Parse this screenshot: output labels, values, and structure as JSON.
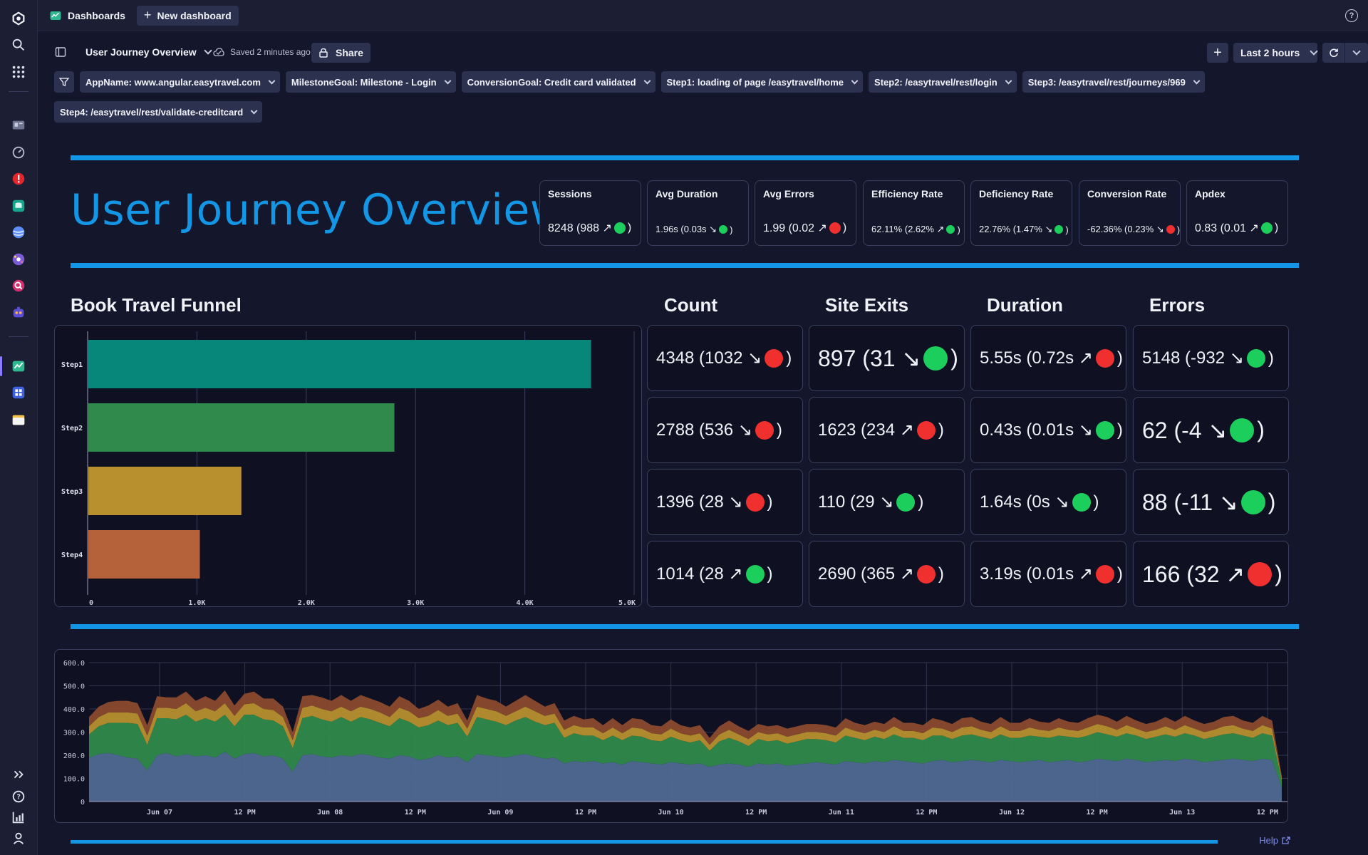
{
  "topbar": {
    "breadcrumb": "Dashboards",
    "new_dashboard": "New dashboard"
  },
  "toolbar": {
    "dashboard_name": "User Journey Overview",
    "saved_status": "Saved 2 minutes ago",
    "share": "Share",
    "timeframe": "Last 2 hours"
  },
  "filters": [
    "AppName: www.angular.easytravel.com",
    "MilestoneGoal: Milestone - Login",
    "ConversionGoal: Credit card validated",
    "Step1: loading of page /easytravel/home",
    "Step2: /easytravel/rest/login",
    "Step3: /easytravel/rest/journeys/969",
    "Step4: /easytravel/rest/validate-creditcard"
  ],
  "header": {
    "title": "User Journey Overview"
  },
  "kpis": [
    {
      "label": "Sessions",
      "value": "8248 (988 ↗",
      "status": "green",
      "close": ")"
    },
    {
      "label": "Avg Duration",
      "value": "1.96s (0.03s ↘",
      "status": "green",
      "close": ")"
    },
    {
      "label": "Avg Errors",
      "value": "1.99 (0.02 ↗",
      "status": "red",
      "close": ")"
    },
    {
      "label": "Efficiency Rate",
      "value": "62.11% (2.62% ↗",
      "status": "green",
      "close": ")"
    },
    {
      "label": "Deficiency Rate",
      "value": "22.76% (1.47% ↘",
      "status": "green",
      "close": ")"
    },
    {
      "label": "Conversion Rate",
      "value": "-62.36% (0.23% ↘",
      "status": "red",
      "close": ")"
    },
    {
      "label": "Apdex",
      "value": "0.83 (0.01 ↗",
      "status": "green",
      "close": ")"
    }
  ],
  "sections": {
    "funnel": "Book Travel Funnel",
    "count": "Count",
    "site_exits": "Site Exits",
    "duration": "Duration",
    "errors": "Errors"
  },
  "tiles": {
    "count": [
      {
        "value": "4348 (1032 ↘",
        "status": "red"
      },
      {
        "value": "2788 (536 ↘",
        "status": "red"
      },
      {
        "value": "1396 (28 ↘",
        "status": "red"
      },
      {
        "value": "1014 (28 ↗",
        "status": "green"
      }
    ],
    "site_exits": [
      {
        "value": "897 (31 ↘",
        "status": "green"
      },
      {
        "value": "1623 (234 ↗",
        "status": "red"
      },
      {
        "value": "110 (29 ↘",
        "status": "green"
      },
      {
        "value": "2690 (365 ↗",
        "status": "red"
      }
    ],
    "duration": [
      {
        "value": "5.55s (0.72s ↗",
        "status": "red"
      },
      {
        "value": "0.43s (0.01s ↘",
        "status": "green"
      },
      {
        "value": "1.64s (0s ↘",
        "status": "green"
      },
      {
        "value": "3.19s (0.01s ↗",
        "status": "red"
      }
    ],
    "errors": [
      {
        "value": "5148 (-932 ↘",
        "status": "green"
      },
      {
        "value": "62 (-4 ↘",
        "status": "green"
      },
      {
        "value": "88 (-11 ↘",
        "status": "green"
      },
      {
        "value": "166 (32 ↗",
        "status": "red"
      }
    ]
  },
  "colors": {
    "accent": "#1496e6",
    "good": "#1ccf5c",
    "bad": "#f0302f"
  },
  "chart_data": [
    {
      "type": "bar",
      "orientation": "horizontal",
      "title": "Book Travel Funnel",
      "categories": [
        "Step1",
        "Step2",
        "Step3",
        "Step4"
      ],
      "values": [
        4600,
        2800,
        1400,
        1020
      ],
      "colors": [
        "#07877a",
        "#2f8a4b",
        "#b8902e",
        "#b5613a"
      ],
      "xlim": [
        0,
        5000
      ],
      "xticks": [
        "0",
        "1.0K",
        "2.0K",
        "3.0K",
        "4.0K",
        "5.0K"
      ],
      "grid": true
    },
    {
      "type": "area",
      "stacked": true,
      "ylim": [
        0,
        600
      ],
      "yticks": [
        "0",
        "100.0",
        "200.0",
        "300.0",
        "400.0",
        "500.0",
        "600.0"
      ],
      "xticks": [
        "Jun 07",
        "12 PM",
        "Jun 08",
        "12 PM",
        "Jun 09",
        "12 PM",
        "Jun 10",
        "12 PM",
        "Jun 11",
        "12 PM",
        "Jun 12",
        "12 PM",
        "Jun 13",
        "12 PM"
      ],
      "series": [
        {
          "color": "#4f6a93",
          "values": [
            190,
            205,
            210,
            200,
            190,
            185,
            135,
            200,
            210,
            195,
            205,
            195,
            200,
            190,
            215,
            185,
            205,
            210,
            195,
            200,
            185,
            130,
            200,
            205,
            195,
            190,
            200,
            195,
            205,
            200,
            190,
            185,
            200,
            195,
            180,
            185,
            200,
            190,
            195,
            170,
            205,
            200,
            195,
            190,
            200,
            205,
            195,
            185,
            190,
            165,
            175,
            170,
            175,
            165,
            170,
            160,
            175,
            170,
            165,
            160,
            170,
            165,
            160,
            165,
            150,
            160,
            165,
            160,
            150,
            165,
            160,
            165,
            155,
            160,
            165,
            170,
            165,
            160,
            175,
            170,
            165,
            175,
            170,
            180,
            175,
            170,
            165,
            175,
            180,
            170,
            175,
            180,
            175,
            170,
            180,
            175,
            170,
            175,
            180,
            170,
            175,
            180,
            170,
            175,
            185,
            180,
            175,
            185,
            180,
            170,
            175,
            180,
            175,
            185,
            180,
            170,
            175,
            180,
            185,
            180,
            175,
            185,
            180,
            60
          ]
        },
        {
          "color": "#2f8a4b",
          "values": [
            100,
            120,
            130,
            140,
            150,
            150,
            110,
            160,
            150,
            160,
            170,
            150,
            160,
            155,
            160,
            140,
            170,
            165,
            160,
            150,
            140,
            100,
            160,
            165,
            160,
            155,
            165,
            150,
            160,
            155,
            150,
            140,
            160,
            150,
            140,
            145,
            150,
            140,
            145,
            110,
            160,
            155,
            150,
            140,
            150,
            160,
            150,
            145,
            150,
            110,
            120,
            115,
            110,
            100,
            115,
            105,
            110,
            110,
            100,
            100,
            110,
            100,
            95,
            100,
            70,
            100,
            110,
            100,
            90,
            105,
            100,
            100,
            95,
            100,
            105,
            100,
            100,
            95,
            110,
            105,
            100,
            105,
            100,
            110,
            100,
            105,
            100,
            110,
            105,
            100,
            110,
            110,
            105,
            100,
            110,
            100,
            105,
            110,
            100,
            105,
            110,
            100,
            105,
            110,
            115,
            110,
            105,
            110,
            105,
            100,
            105,
            110,
            105,
            110,
            105,
            100,
            105,
            110,
            110,
            105,
            100,
            110,
            105,
            30
          ]
        },
        {
          "color": "#b8902e",
          "values": [
            35,
            40,
            45,
            45,
            45,
            45,
            40,
            45,
            45,
            45,
            50,
            45,
            45,
            45,
            50,
            45,
            45,
            50,
            45,
            45,
            40,
            35,
            45,
            45,
            45,
            45,
            45,
            45,
            45,
            45,
            45,
            40,
            45,
            45,
            40,
            40,
            45,
            40,
            40,
            35,
            45,
            45,
            45,
            40,
            40,
            45,
            45,
            40,
            40,
            35,
            35,
            35,
            35,
            30,
            35,
            30,
            35,
            35,
            30,
            30,
            35,
            30,
            30,
            30,
            25,
            30,
            35,
            30,
            30,
            30,
            30,
            30,
            30,
            30,
            30,
            30,
            30,
            30,
            35,
            30,
            30,
            30,
            30,
            35,
            30,
            30,
            30,
            35,
            30,
            30,
            35,
            35,
            30,
            30,
            35,
            30,
            30,
            35,
            30,
            30,
            35,
            30,
            30,
            35,
            35,
            35,
            30,
            35,
            30,
            30,
            30,
            35,
            30,
            35,
            30,
            30,
            30,
            35,
            35,
            30,
            30,
            35,
            30,
            10
          ]
        },
        {
          "color": "#8b4a2e",
          "values": [
            40,
            45,
            45,
            50,
            50,
            45,
            45,
            50,
            45,
            50,
            50,
            45,
            50,
            45,
            55,
            45,
            45,
            50,
            45,
            50,
            45,
            35,
            50,
            45,
            50,
            45,
            50,
            45,
            50,
            45,
            45,
            45,
            50,
            45,
            40,
            45,
            45,
            40,
            45,
            35,
            50,
            45,
            45,
            40,
            45,
            50,
            45,
            40,
            45,
            40,
            40,
            35,
            40,
            35,
            40,
            35,
            40,
            40,
            35,
            35,
            40,
            35,
            35,
            35,
            30,
            35,
            40,
            35,
            35,
            35,
            35,
            35,
            35,
            35,
            35,
            35,
            35,
            35,
            40,
            35,
            35,
            35,
            35,
            40,
            35,
            35,
            35,
            40,
            35,
            35,
            40,
            40,
            35,
            35,
            40,
            35,
            35,
            40,
            35,
            35,
            40,
            35,
            35,
            40,
            40,
            40,
            35,
            40,
            35,
            35,
            35,
            40,
            35,
            40,
            35,
            35,
            35,
            40,
            40,
            35,
            35,
            40,
            35,
            10
          ]
        }
      ]
    }
  ],
  "footer": {
    "help": "Help"
  }
}
